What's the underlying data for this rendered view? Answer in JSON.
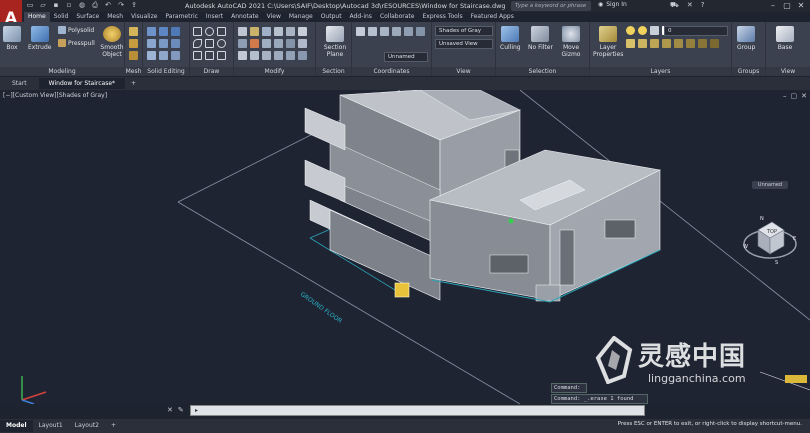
{
  "app": {
    "logo_letter": "A",
    "title": "Autodesk AutoCAD 2021    C:\\Users\\SAIF\\Desktop\\Autocad 3d\\rESOURCES\\Window for Staircase.dwg",
    "search_placeholder": "Type a keyword or phrase",
    "signin_label": "Sign In"
  },
  "ribbon_tabs": [
    "Home",
    "Solid",
    "Surface",
    "Mesh",
    "Visualize",
    "Parametric",
    "Insert",
    "Annotate",
    "View",
    "Manage",
    "Output",
    "Add-ins",
    "Collaborate",
    "Express Tools",
    "Featured Apps"
  ],
  "ribbon": {
    "modeling": {
      "label": "Modeling",
      "box": "Box",
      "extrude": "Extrude",
      "polysolid": "Polysolid",
      "presspull": "Presspull",
      "smooth_object": "Smooth Object"
    },
    "mesh_label": "Mesh",
    "solid_editing_label": "Solid Editing",
    "draw_label": "Draw",
    "modify_label": "Modify",
    "section": {
      "label": "Section",
      "section_plane": "Section Plane"
    },
    "coordinates": {
      "label": "Coordinates",
      "ucs_combo": "Unnamed"
    },
    "view": {
      "label": "View",
      "visual_style": "Shades of Gray",
      "named_view": "Unsaved View"
    },
    "selection": {
      "label": "Selection",
      "culling": "Culling",
      "no_filter": "No Filter",
      "move_gizmo": "Move Gizmo"
    },
    "layers": {
      "label": "Layers",
      "layer_properties": "Layer Properties",
      "layer_combo": "0"
    },
    "groups": {
      "label": "Groups",
      "group": "Group"
    },
    "viewpanel": {
      "label": "View",
      "base": "Base"
    }
  },
  "doc_tabs": [
    "Start",
    "Window for Staircase*"
  ],
  "viewport": {
    "label": "[−][Custom View][Shades of Gray]",
    "annotation": "GROUND FLOOR",
    "viewcube_face": "TOP",
    "viewcube_compass": [
      "N",
      "S",
      "E",
      "W"
    ],
    "ucs_name": "Unnamed"
  },
  "command": {
    "history": [
      "Command:",
      "Command: _.erase 1 found"
    ],
    "placeholder": ""
  },
  "layout_tabs": [
    "Model",
    "Layout1",
    "Layout2"
  ],
  "status_message": "Press ESC or ENTER to exit, or right-click to display shortcut-menu.",
  "watermark": {
    "chinese": "灵感中国",
    "url": "lingganchina.com"
  },
  "colors": {
    "accent": "#a8241f",
    "ribbon_bg": "#3b414e",
    "viewport_bg": "#1f2433",
    "grip": "#e8c23a"
  }
}
